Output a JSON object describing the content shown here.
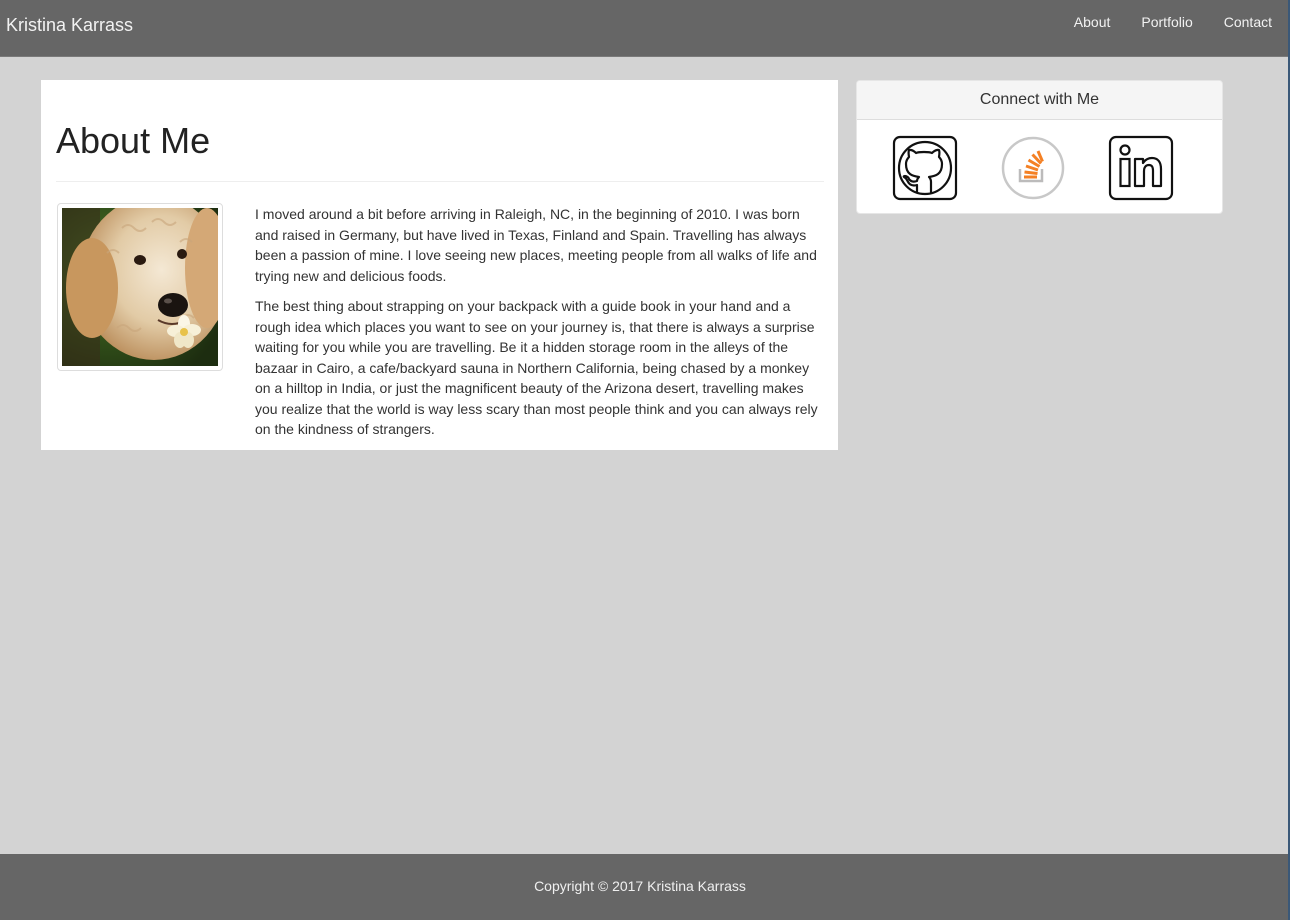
{
  "navbar": {
    "brand": "Kristina Karrass",
    "links": [
      "About",
      "Portfolio",
      "Contact"
    ]
  },
  "main": {
    "title": "About Me",
    "photo_icon": "dog-photo",
    "paragraphs": [
      "I moved around a bit before arriving in Raleigh, NC, in the beginning of 2010. I was born and raised in Germany, but have lived in Texas, Finland and Spain. Travelling has always been a passion of mine. I love seeing new places, meeting people from all walks of life and trying new and delicious foods.",
      "The best thing about strapping on your backpack with a guide book in your hand and a rough idea which places you want to see on your journey is, that there is always a surprise waiting for you while you are travelling. Be it a hidden storage room in the alleys of the bazaar in Cairo, a cafe/backyard sauna in Northern California, being chased by a monkey on a hilltop in India, or just the magnificent beauty of the Arizona desert, travelling makes you realize that the world is way less scary than most people think and you can always rely on the kindness of strangers."
    ]
  },
  "sidebar": {
    "heading": "Connect with Me",
    "icons": [
      "github-icon",
      "stackoverflow-icon",
      "linkedin-icon"
    ]
  },
  "footer": {
    "copyright": "Copyright © 2017 Kristina Karrass"
  },
  "colors": {
    "navbar_bg": "#666666",
    "page_bg": "#d3d3d3",
    "stackoverflow_orange": "#f48024"
  }
}
